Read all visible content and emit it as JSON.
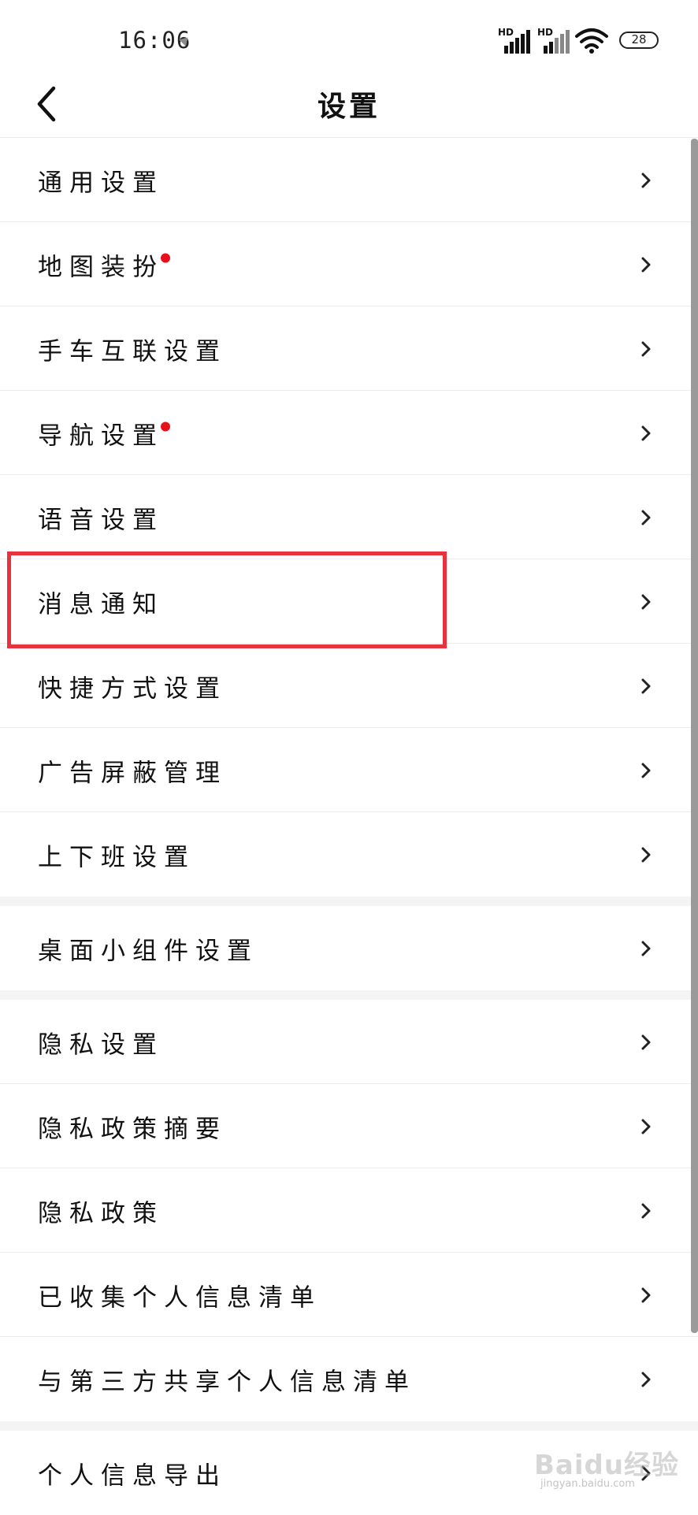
{
  "status_bar": {
    "time": "16:06",
    "signal1_label": "HD",
    "signal2_label": "HD",
    "battery": "28"
  },
  "header": {
    "title": "设置"
  },
  "groups": [
    {
      "items": [
        {
          "label": "通用设置",
          "dot": false
        },
        {
          "label": "地图装扮",
          "dot": true
        },
        {
          "label": "手车互联设置",
          "dot": false
        },
        {
          "label": "导航设置",
          "dot": true
        },
        {
          "label": "语音设置",
          "dot": false
        },
        {
          "label": "消息通知",
          "dot": false
        },
        {
          "label": "快捷方式设置",
          "dot": false
        },
        {
          "label": "广告屏蔽管理",
          "dot": false
        },
        {
          "label": "上下班设置",
          "dot": false
        }
      ]
    },
    {
      "items": [
        {
          "label": "桌面小组件设置",
          "dot": false
        }
      ]
    },
    {
      "items": [
        {
          "label": "隐私设置",
          "dot": false
        },
        {
          "label": "隐私政策摘要",
          "dot": false
        },
        {
          "label": "隐私政策",
          "dot": false
        },
        {
          "label": "已收集个人信息清单",
          "dot": false
        },
        {
          "label": "与第三方共享个人信息清单",
          "dot": false
        }
      ]
    },
    {
      "items": [
        {
          "label": "个人信息导出",
          "dot": false
        }
      ]
    }
  ],
  "highlight": {
    "target": "消息通知",
    "color": "#e8333e"
  },
  "colors": {
    "dot": "#e8101c",
    "divider": "#ededed",
    "group_gap": "#f4f4f4"
  },
  "icons": {
    "back": "chevron-left-icon",
    "row": "chevron-right-icon"
  },
  "watermark": {
    "logo": "Baidu经验",
    "sub": "jingyan.baidu.com"
  }
}
